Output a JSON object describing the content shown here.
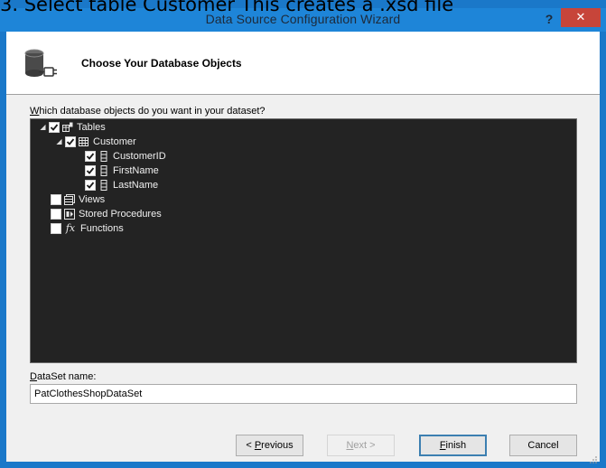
{
  "caption": "3. Select table Customer This creates a .xsd file",
  "window": {
    "title": "Data Source Configuration Wizard",
    "help_label": "?",
    "close_label": "✕"
  },
  "header": {
    "title": "Choose Your Database Objects",
    "icon": "database-connect-icon"
  },
  "objects": {
    "prompt_accel": "W",
    "prompt_rest": "hich database objects do you want in your dataset?",
    "tree": {
      "tables": {
        "label": "Tables",
        "checked": true,
        "expanded": true,
        "icon": "tables-icon"
      },
      "customer": {
        "label": "Customer",
        "checked": true,
        "expanded": true,
        "icon": "table-icon"
      },
      "customer_id": {
        "label": "CustomerID",
        "checked": true,
        "icon": "column-icon"
      },
      "first_name": {
        "label": "FirstName",
        "checked": true,
        "icon": "column-icon"
      },
      "last_name": {
        "label": "LastName",
        "checked": true,
        "icon": "column-icon"
      },
      "views": {
        "label": "Views",
        "checked": false,
        "icon": "views-icon"
      },
      "stored_procedures": {
        "label": "Stored Procedures",
        "checked": false,
        "icon": "stored-procedure-icon"
      },
      "functions": {
        "label": "Functions",
        "checked": false,
        "icon": "function-icon",
        "glyph": "fx"
      }
    }
  },
  "dataset": {
    "label_accel": "D",
    "label_rest": "ataSet name:",
    "value": "PatClothesShopDataSet"
  },
  "buttons": {
    "previous": {
      "prefix": "< ",
      "accel": "P",
      "rest": "revious"
    },
    "next": {
      "accel": "N",
      "rest": "ext >"
    },
    "finish": {
      "accel": "F",
      "rest": "inish"
    },
    "cancel": "Cancel"
  }
}
